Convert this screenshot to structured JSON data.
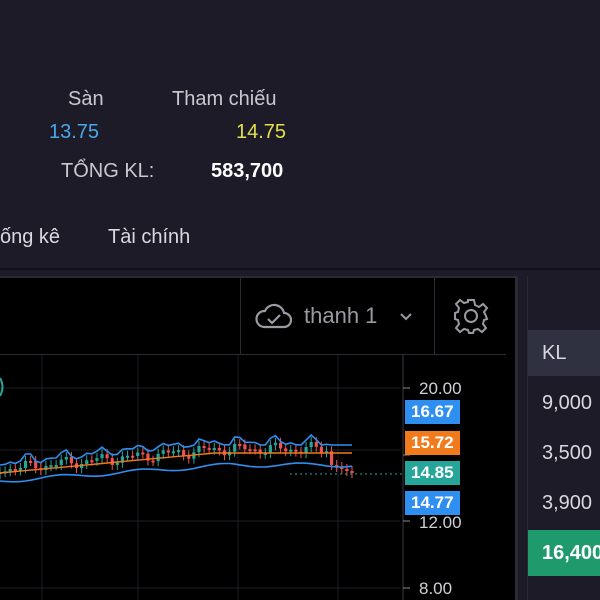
{
  "header": {
    "floor_label": "Sàn",
    "floor_value": "13.75",
    "reference_label": "Tham chiếu",
    "reference_value": "14.75",
    "total_volume_label": "TỔNG KL:",
    "total_volume_value": "583,700"
  },
  "tabs": [
    {
      "label": "ống kê"
    },
    {
      "label": "Tài chính"
    }
  ],
  "toolbar": {
    "interval_label": "thanh 1",
    "interval_icon": "cloud-check-icon",
    "settings_icon": "gear-icon"
  },
  "chart": {
    "axis_ticks": [
      "20.00",
      "12.00",
      "8.00"
    ],
    "price_labels": [
      {
        "value": "16.67",
        "color": "#2f8ff0"
      },
      {
        "value": "15.72",
        "color": "#f07a1c"
      },
      {
        "value": "14.85",
        "color": "#26a69a"
      },
      {
        "value": "14.77",
        "color": "#2f8ff0"
      }
    ]
  },
  "chart_data": {
    "type": "line",
    "y_axis_ticks": [
      20.0,
      12.0,
      8.0
    ],
    "price_markers": [
      16.67,
      15.72,
      14.85,
      14.77
    ]
  },
  "order_book": {
    "column_header": "KL",
    "rows": [
      "9,000",
      "3,500",
      "3,900"
    ],
    "highlight": "16,400"
  },
  "colors": {
    "background": "#1c1b27",
    "chart_background": "#000000",
    "floor": "#4aa8ea",
    "reference": "#e3e04c",
    "up": "#26a69a",
    "down": "#ef5350",
    "band": "#2f8ff0",
    "ma": "#f07a1c"
  }
}
